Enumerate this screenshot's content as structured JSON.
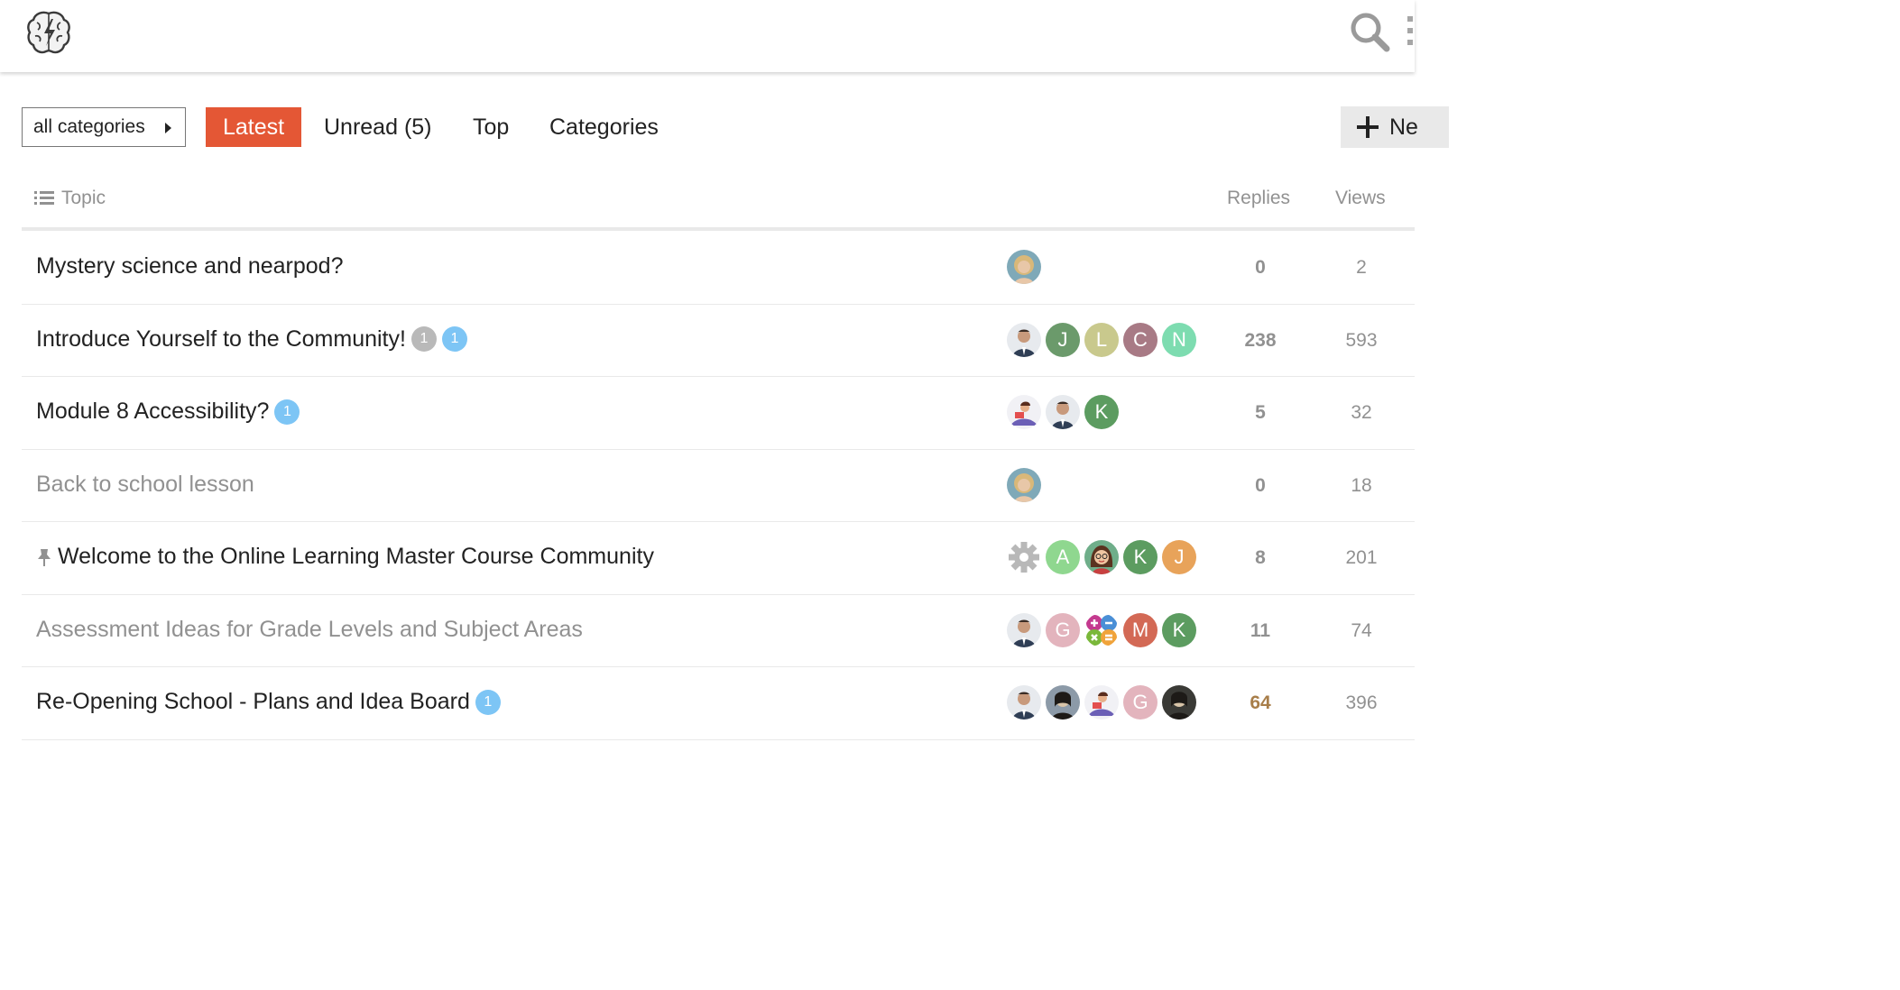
{
  "header": {
    "logo": "brain-bolt-logo",
    "search_icon": "search-icon",
    "menu_icon": "vertical-dots-icon"
  },
  "nav": {
    "category_dropdown": "all categories",
    "tabs": [
      {
        "label": "Latest",
        "active": true
      },
      {
        "label": "Unread (5)",
        "active": false
      },
      {
        "label": "Top",
        "active": false
      },
      {
        "label": "Categories",
        "active": false
      }
    ],
    "new_topic_label": "Ne",
    "accent_color": "#e45735"
  },
  "table": {
    "columns": {
      "topic": "Topic",
      "replies": "Replies",
      "views": "Views"
    },
    "rows": [
      {
        "title": "Mystery science and nearpod?",
        "visited": false,
        "pinned": false,
        "badges": [],
        "posters": [
          "photo"
        ],
        "replies": "0",
        "views": "2",
        "hot": false
      },
      {
        "title": "Introduce Yourself to the Community!",
        "visited": false,
        "pinned": false,
        "badges": [
          {
            "text": "1",
            "color": "grey"
          },
          {
            "text": "1",
            "color": "blue"
          }
        ],
        "posters": [
          "photo",
          "J",
          "L",
          "C",
          "N"
        ],
        "replies": "238",
        "views": "593",
        "hot": false
      },
      {
        "title": "Module 8 Accessibility?",
        "visited": false,
        "pinned": false,
        "badges": [
          {
            "text": "1",
            "color": "blue"
          }
        ],
        "posters": [
          "illustration",
          "photo",
          "K"
        ],
        "replies": "5",
        "views": "32",
        "hot": false
      },
      {
        "title": "Back to school lesson",
        "visited": true,
        "pinned": false,
        "badges": [],
        "posters": [
          "photo"
        ],
        "replies": "0",
        "views": "18",
        "hot": false
      },
      {
        "title": "Welcome to the Online Learning Master Course Community",
        "visited": false,
        "pinned": true,
        "badges": [],
        "posters": [
          "gear",
          "A",
          "cartoon",
          "K",
          "J"
        ],
        "replies": "8",
        "views": "201",
        "hot": false
      },
      {
        "title": "Assessment Ideas for Grade Levels and Subject Areas",
        "visited": true,
        "pinned": false,
        "badges": [],
        "posters": [
          "photo",
          "G",
          "math-symbols",
          "M",
          "K"
        ],
        "replies": "11",
        "views": "74",
        "hot": false
      },
      {
        "title": "Re-Opening School - Plans and Idea Board",
        "visited": false,
        "pinned": false,
        "badges": [
          {
            "text": "1",
            "color": "blue"
          }
        ],
        "posters": [
          "photo",
          "photo",
          "illustration",
          "G",
          "photo"
        ],
        "replies": "64",
        "views": "396",
        "hot": true
      }
    ]
  }
}
